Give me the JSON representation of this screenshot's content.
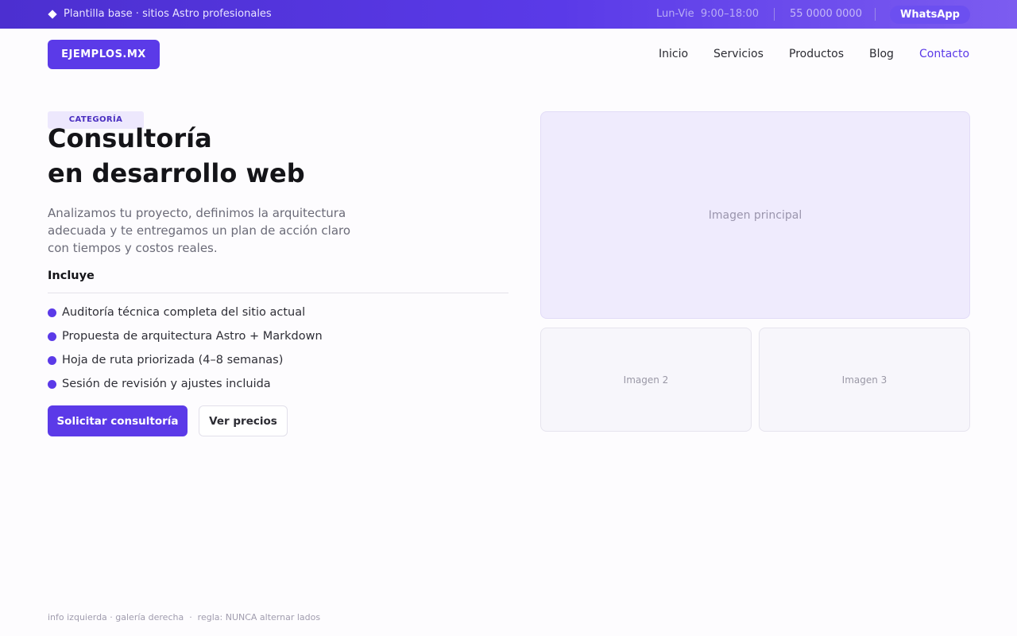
{
  "topbar": {
    "brand_text": "Plantilla base · sitios Astro profesionales",
    "hours": "Lun-Vie  9:00–18:00",
    "phone": "55 0000 0000",
    "whatsapp_label": "WhatsApp"
  },
  "header": {
    "logo": "EJEMPLOS.MX",
    "nav": [
      {
        "label": "Inicio"
      },
      {
        "label": "Servicios"
      },
      {
        "label": "Productos"
      },
      {
        "label": "Blog"
      },
      {
        "label": "Contacto",
        "active": true
      }
    ]
  },
  "hero": {
    "tag": "CATEGORÍA",
    "title_line1": "Consultoría",
    "title_line2": "en desarrollo web",
    "description": "Analizamos tu proyecto, definimos la arquitectura adecuada y te entregamos un plan de acción claro con tiempos y costos reales.",
    "includes_title": "Incluye",
    "features": [
      "Auditoría técnica completa del sitio actual",
      "Propuesta de arquitectura Astro + Markdown",
      "Hoja de ruta priorizada (4–8 semanas)",
      "Sesión de revisión y ajustes incluida"
    ],
    "primary_cta": "Solicitar consultoría",
    "secondary_cta": "Ver precios"
  },
  "gallery": {
    "main": "Imagen principal",
    "second": "Imagen 2",
    "third": "Imagen 3"
  },
  "footnote": "info izquierda · galería derecha  ·  regla: NUNCA alternar lados",
  "colors": {
    "accent": "#5b3ae8",
    "topbar_start": "#4c2fd0",
    "topbar_end": "#7c5cf0",
    "tag_bg": "#ede8fd",
    "image_main_bg": "#efebfd"
  }
}
